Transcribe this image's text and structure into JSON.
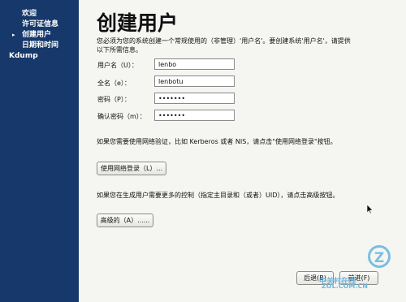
{
  "sidebar": {
    "items": [
      {
        "label": "欢迎"
      },
      {
        "label": "许可证信息"
      },
      {
        "label": "创建用户"
      },
      {
        "label": "日期和时间"
      },
      {
        "label": "Kdump"
      }
    ],
    "current_marker": "▸"
  },
  "page": {
    "title": "创建用户",
    "intro": "您必须为您的系统创建一个常规使用的（非管理）'用户名'。要创建系统'用户名'，请提供以下所需信息。"
  },
  "form": {
    "username_label": "用户名（U）：",
    "username_value": "lenbo",
    "fullname_label": "全名（e）：",
    "fullname_value": "lenbotu",
    "password_label": "密码（P）：",
    "password_value": "•••••••",
    "confirm_label": "确认密码（m）：",
    "confirm_value": "•••••••"
  },
  "network": {
    "note": "如果您需要使用网络验证，比如 Kerberos 或者 NIS，请点击\"使用网络登录\"按钮。",
    "button": "使用网络登录（L）..."
  },
  "advanced": {
    "note": "如果您在生成用户需要更多的控制（指定主目录和（或者）UID），请点击高级按钮。",
    "button": "高级的（A）......"
  },
  "footer": {
    "back": "后退(B)",
    "forward": "前进(F)"
  },
  "watermark": {
    "text1": "中关村在线",
    "text2": "ZOL.COM.CN",
    "logo": "Z"
  }
}
